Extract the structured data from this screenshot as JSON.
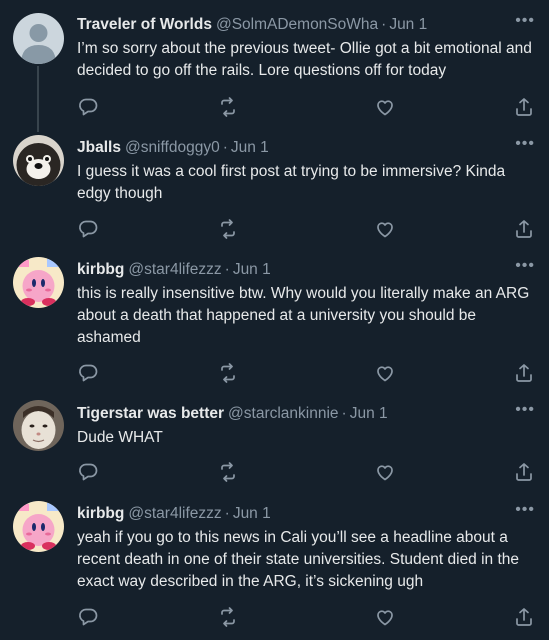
{
  "tweets": [
    {
      "name": "Traveler of Worlds",
      "handle": "@SolmADemonSoWha",
      "date": "Jun 1",
      "text": "I’m so sorry about the previous tweet- Ollie got a bit emotional and decided to go off the rails. Lore questions off for today",
      "avatar": "default-avatar"
    },
    {
      "name": "Jballs",
      "handle": "@sniffdoggy0",
      "date": "Jun 1",
      "text": "I guess it was a cool first post at trying to be immersive? Kinda edgy though",
      "avatar": "dog-avatar"
    },
    {
      "name": "kirbbg",
      "handle": "@star4lifezzz",
      "date": "Jun 1",
      "text": "this is really insensitive btw. Why would you literally make an ARG about a death that happened at a university you should be ashamed",
      "avatar": "kirby-avatar"
    },
    {
      "name": "Tigerstar was better",
      "handle": "@starclankinnie",
      "date": "Jun 1",
      "text": "Dude WHAT",
      "avatar": "cat-face-avatar"
    },
    {
      "name": "kirbbg",
      "handle": "@star4lifezzz",
      "date": "Jun 1",
      "text": "yeah if you go to this news in Cali you’ll see a headline about a recent death in one of their state universities. Student died in the exact way described in the ARG, it’s sickening ugh",
      "avatar": "kirby-avatar"
    }
  ],
  "ui": {
    "dot": "·",
    "more": "•••"
  },
  "colors": {
    "background": "#15202b",
    "text": "#e7e9ea",
    "muted": "#8b98a5",
    "thread_line": "#38444d"
  }
}
